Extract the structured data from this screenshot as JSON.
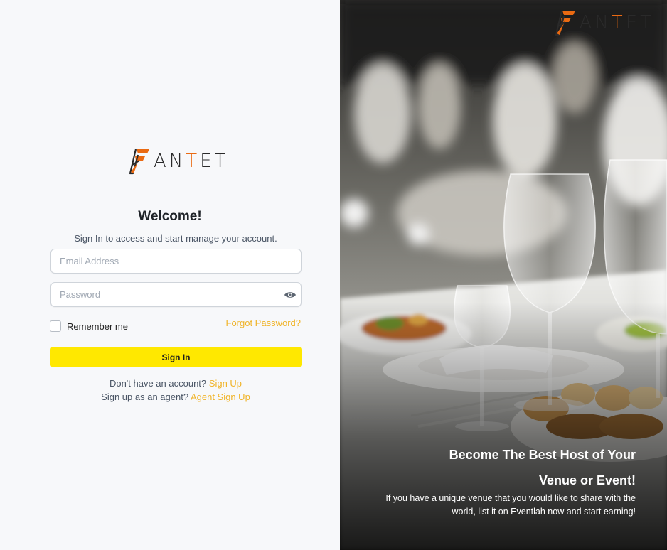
{
  "brand": {
    "name_prefix": "AN",
    "name_accent": "T",
    "name_suffix": "ET",
    "accent_color": "#ea6a12"
  },
  "login": {
    "title": "Welcome!",
    "subtitle": "Sign In to access and start manage your account.",
    "email_placeholder": "Email Address",
    "password_placeholder": "Password",
    "remember_label": "Remember me",
    "forgot_label": "Forgot Password?",
    "signin_label": "Sign In",
    "signup_prompt": "Don't have an account?",
    "signup_link": "Sign Up",
    "agent_prompt": "Sign up as an agent?",
    "agent_link": "Agent Sign Up"
  },
  "promo": {
    "headline_line1": "Become The Best Host of Your",
    "headline_line2": "Venue or Event!",
    "blurb_line1": "If you have a unique venue that you would like to share with the",
    "blurb_line2": "world, list it on Eventlah now and start earning!"
  },
  "colors": {
    "button": "#ffe800",
    "link": "#f0b429"
  },
  "icons": {
    "brand_mark": "fantet-logo-mark",
    "password_toggle": "eye-icon"
  }
}
